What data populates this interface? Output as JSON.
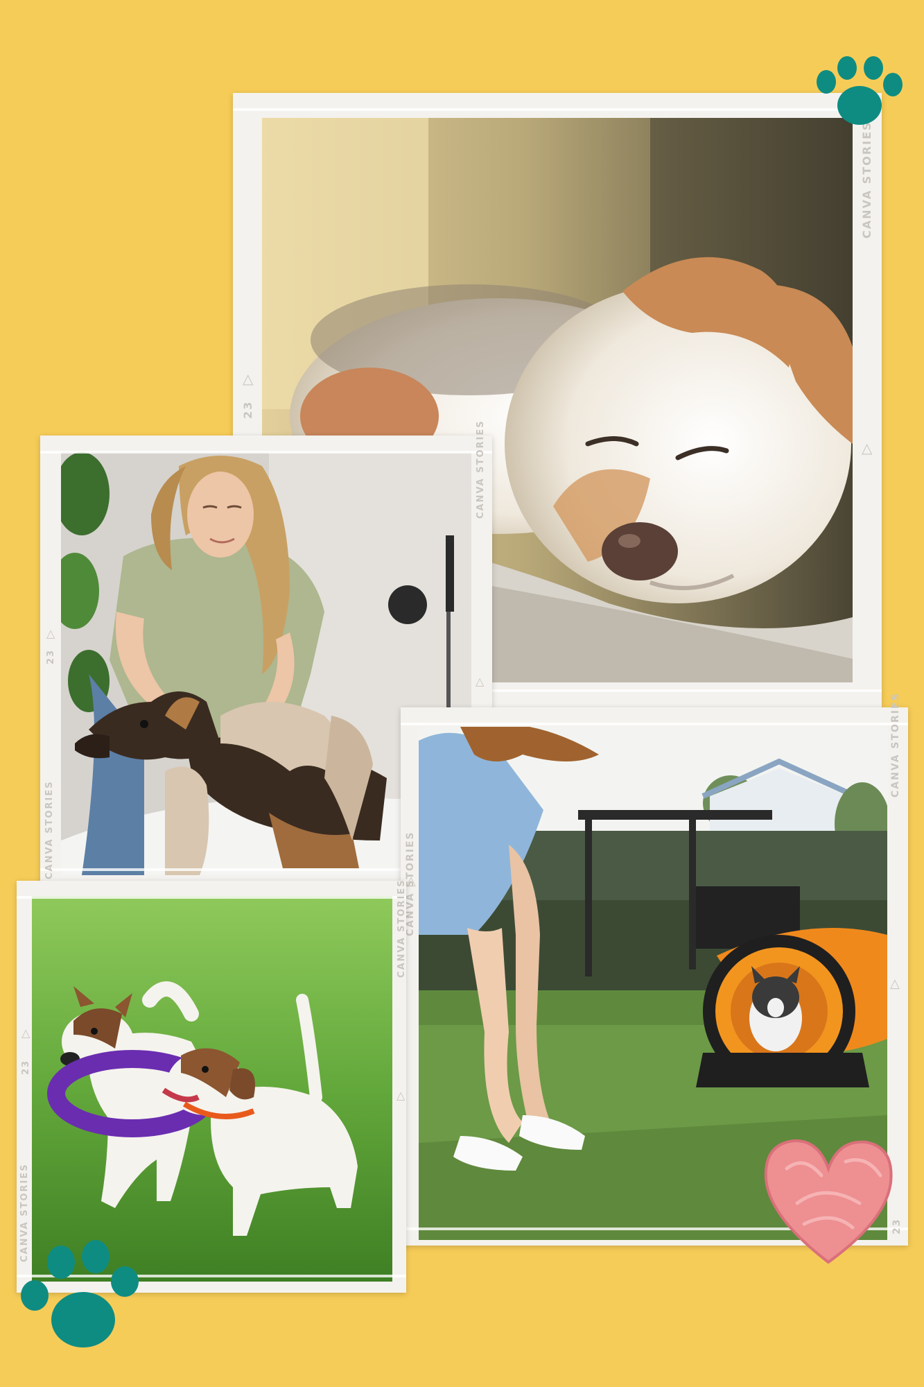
{
  "background_color": "#f6cc58",
  "accent_teal": "#0e8c82",
  "heart_color": "#ee8f92",
  "frames": {
    "brand": "CANVA STORIES",
    "number": "23",
    "arrow": "△"
  },
  "photos": [
    {
      "subject": "sleeping-dog"
    },
    {
      "subject": "woman-drying-dog-with-towel"
    },
    {
      "subject": "dog-agility-tunnel"
    },
    {
      "subject": "two-terriers-playing-with-ring"
    }
  ],
  "decorations": [
    "paw-print-icon",
    "paw-print-icon",
    "heart-icon"
  ]
}
